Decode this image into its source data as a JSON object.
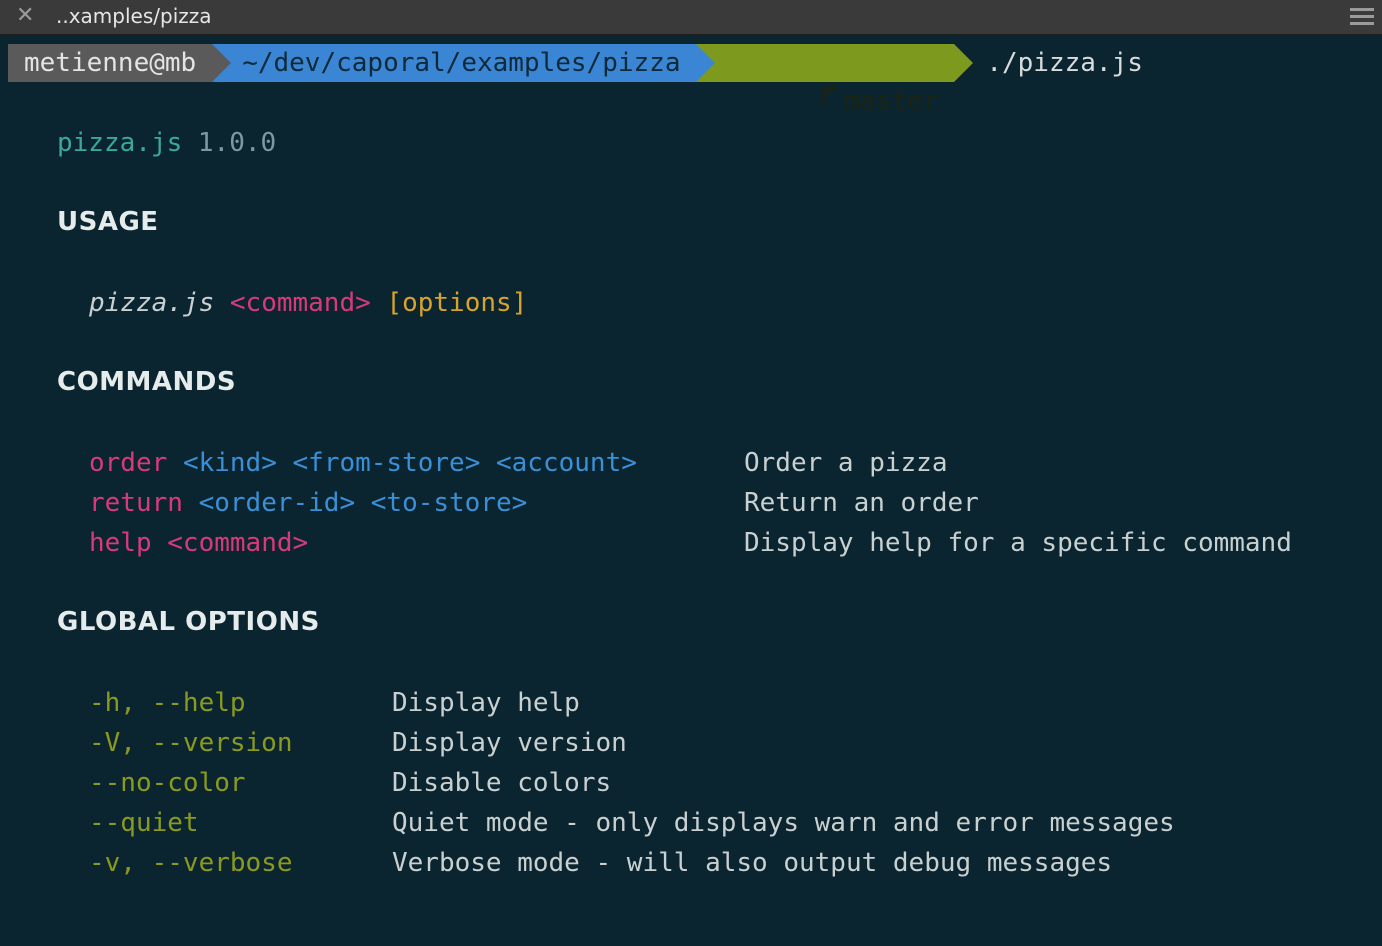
{
  "window": {
    "title": "..xamples/pizza"
  },
  "prompt": {
    "user": "metienne@mb",
    "path": "~/dev/caporal/examples/pizza",
    "branch": "master",
    "command": "./pizza.js"
  },
  "program": {
    "name": "pizza.js",
    "version": "1.0.0"
  },
  "usage": {
    "heading": "USAGE",
    "program": "pizza.js",
    "command_arg": "<command>",
    "options_arg": "[options]"
  },
  "commands": {
    "heading": "COMMANDS",
    "items": [
      {
        "name": "order",
        "args": "<kind> <from-store> <account>",
        "description": "Order a pizza"
      },
      {
        "name": "return",
        "args": "<order-id> <to-store>",
        "description": "Return an order"
      },
      {
        "name": "help",
        "args": "<command>",
        "description": "Display help for a specific command"
      }
    ]
  },
  "global_options": {
    "heading": "GLOBAL OPTIONS",
    "items": [
      {
        "flag": "-h, --help",
        "description": "Display help"
      },
      {
        "flag": "-V, --version",
        "description": "Display version"
      },
      {
        "flag": "--no-color",
        "description": "Disable colors"
      },
      {
        "flag": "--quiet",
        "description": "Quiet mode - only displays warn and error messages"
      },
      {
        "flag": "-v, --verbose",
        "description": "Verbose mode - will also output debug messages"
      }
    ]
  },
  "colors": {
    "background": "#0b2530",
    "command_name": "#d63a7a",
    "argument": "#3a8fd6",
    "option_flag": "#8a9a1e",
    "options_bracket": "#d8a32a"
  },
  "icons": {
    "close": "close-icon",
    "menu": "hamburger-menu-icon",
    "branch": "git-branch-icon"
  }
}
